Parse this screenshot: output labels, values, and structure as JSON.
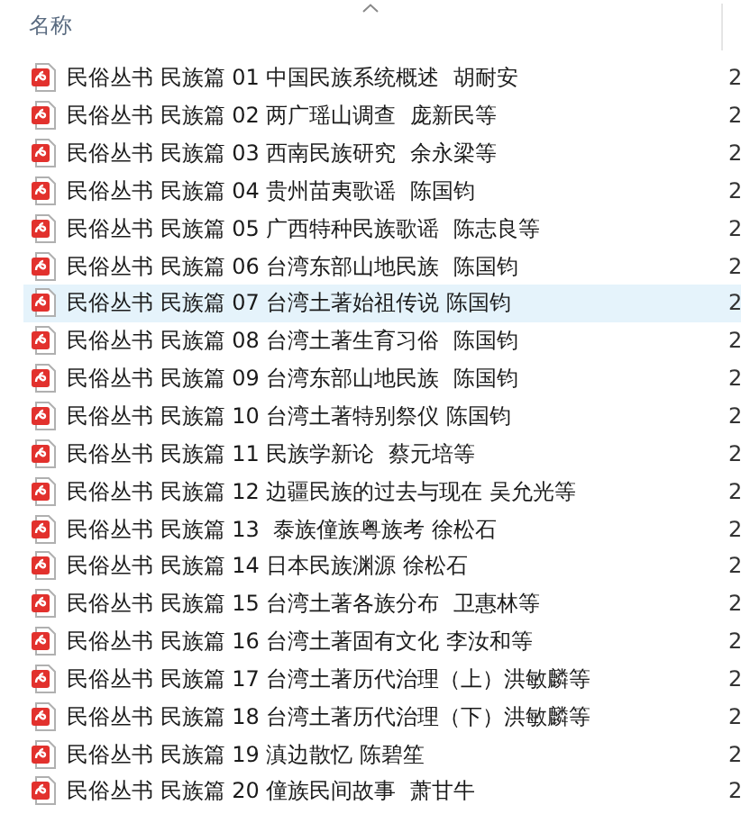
{
  "header": {
    "name_column": "名称"
  },
  "files": [
    {
      "name": "民俗丛书 民族篇 01 中国民族系统概述  胡耐安",
      "date": "2",
      "selected": false
    },
    {
      "name": "民俗丛书 民族篇 02 两广瑶山调查  庞新民等",
      "date": "2",
      "selected": false
    },
    {
      "name": "民俗丛书 民族篇 03 西南民族研究  余永梁等",
      "date": "2",
      "selected": false
    },
    {
      "name": "民俗丛书 民族篇 04 贵州苗夷歌谣  陈国钧",
      "date": "2",
      "selected": false
    },
    {
      "name": "民俗丛书 民族篇 05 广西特种民族歌谣  陈志良等",
      "date": "2",
      "selected": false
    },
    {
      "name": "民俗丛书 民族篇 06 台湾东部山地民族  陈国钧",
      "date": "2",
      "selected": false
    },
    {
      "name": "民俗丛书 民族篇 07 台湾土著始祖传说 陈国钧",
      "date": "2",
      "selected": true
    },
    {
      "name": "民俗丛书 民族篇 08 台湾土著生育习俗  陈国钧",
      "date": "2",
      "selected": false
    },
    {
      "name": "民俗丛书 民族篇 09 台湾东部山地民族  陈国钧",
      "date": "2",
      "selected": false
    },
    {
      "name": "民俗丛书 民族篇 10 台湾土著特别祭仪 陈国钧",
      "date": "2",
      "selected": false
    },
    {
      "name": "民俗丛书 民族篇 11 民族学新论  蔡元培等",
      "date": "2",
      "selected": false
    },
    {
      "name": "民俗丛书 民族篇 12 边疆民族的过去与现在 吴允光等",
      "date": "2",
      "selected": false
    },
    {
      "name": "民俗丛书 民族篇 13  泰族僮族粤族考 徐松石",
      "date": "2",
      "selected": false
    },
    {
      "name": "民俗丛书 民族篇 14 日本民族渊源 徐松石",
      "date": "2",
      "selected": false
    },
    {
      "name": "民俗丛书 民族篇 15 台湾土著各族分布  卫惠林等",
      "date": "2",
      "selected": false
    },
    {
      "name": "民俗丛书 民族篇 16 台湾土著固有文化 李汝和等",
      "date": "2",
      "selected": false
    },
    {
      "name": "民俗丛书 民族篇 17 台湾土著历代治理（上）洪敏麟等",
      "date": "2",
      "selected": false
    },
    {
      "name": "民俗丛书 民族篇 18 台湾土著历代治理（下）洪敏麟等",
      "date": "2",
      "selected": false
    },
    {
      "name": "民俗丛书 民族篇 19 滇边散忆 陈碧笙",
      "date": "2",
      "selected": false
    },
    {
      "name": "民俗丛书 民族篇 20 僮族民间故事  萧甘牛",
      "date": "2",
      "selected": false
    }
  ]
}
